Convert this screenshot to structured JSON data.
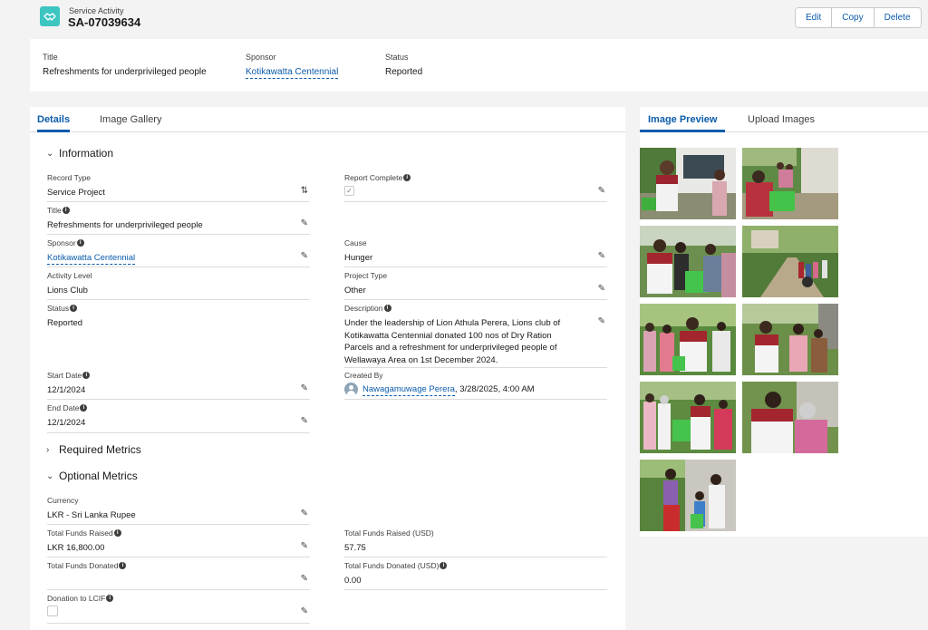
{
  "header": {
    "object_label": "Service Activity",
    "record_name": "SA-07039634",
    "edit_label": "Edit",
    "copy_label": "Copy",
    "delete_label": "Delete"
  },
  "highlights": {
    "title_label": "Title",
    "title_value": "Refreshments for underprivileged people",
    "sponsor_label": "Sponsor",
    "sponsor_value": "Kotikawatta Centennial",
    "status_label": "Status",
    "status_value": "Reported"
  },
  "main_tabs": {
    "details": "Details",
    "gallery": "Image Gallery"
  },
  "sections": {
    "information": "Information",
    "required_metrics": "Required Metrics",
    "optional_metrics": "Optional Metrics"
  },
  "fields": {
    "record_type_label": "Record Type",
    "record_type_value": "Service Project",
    "report_complete_label": "Report Complete",
    "title_label": "Title",
    "title_value": "Refreshments for underprivileged people",
    "sponsor_label": "Sponsor",
    "sponsor_value": "Kotikawatta Centennial",
    "cause_label": "Cause",
    "cause_value": "Hunger",
    "activity_level_label": "Activity Level",
    "activity_level_value": "Lions Club",
    "project_type_label": "Project Type",
    "project_type_value": "Other",
    "status_label": "Status",
    "status_value": "Reported",
    "description_label": "Description",
    "description_value": "Under the leadership of Lion Athula Perera, Lions club of Kotikawatta Centennial donated 100 nos of Dry Ration Parcels and a refreshment for underprivileged people of Wellawaya Area on 1st December 2024.",
    "start_date_label": "Start Date",
    "start_date_value": "12/1/2024",
    "created_by_label": "Created By",
    "created_by_name": "Nawagamuwage Perera",
    "created_by_date": ", 3/28/2025, 4:00 AM",
    "end_date_label": "End Date",
    "end_date_value": "12/1/2024",
    "currency_label": "Currency",
    "currency_value": "LKR - Sri Lanka Rupee",
    "funds_raised_label": "Total Funds Raised",
    "funds_raised_value": "LKR 16,800.00",
    "funds_raised_usd_label": "Total Funds Raised (USD)",
    "funds_raised_usd_value": "57.75",
    "funds_donated_label": "Total Funds Donated",
    "funds_donated_value": "",
    "funds_donated_usd_label": "Total Funds Donated (USD)",
    "funds_donated_usd_value": "0.00",
    "donation_lcif_label": "Donation to LCIF"
  },
  "side_tabs": {
    "preview": "Image Preview",
    "upload": "Upload Images"
  },
  "colors": {
    "brand_blue": "#0b5cab",
    "object_icon": "#3cc5c1",
    "border": "#dddbda"
  },
  "icons": [
    "handshake-icon",
    "chevron-down-icon",
    "chevron-right-icon",
    "pencil-icon",
    "swap-icon",
    "info-icon",
    "check-icon",
    "avatar-icon"
  ]
}
